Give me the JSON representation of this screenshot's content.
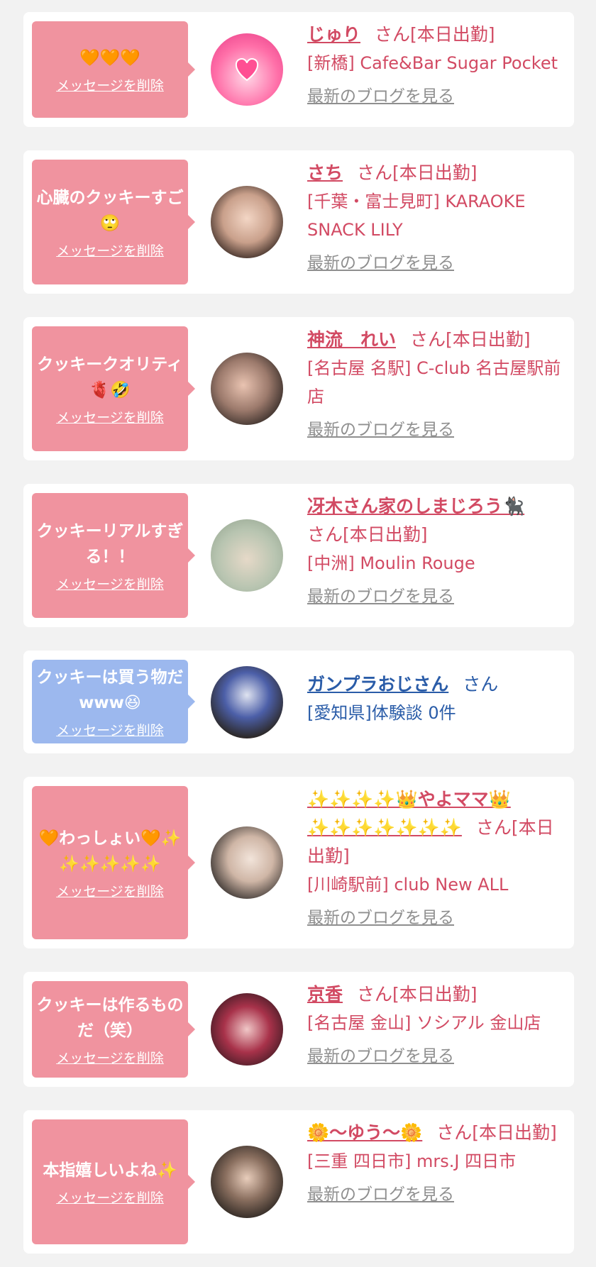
{
  "delete_label": "メッセージを削除",
  "blog_label": "最新のブログを見る",
  "cards": [
    {
      "message": "🧡🧡🧡",
      "name": "じゅり",
      "suffix": "さん[本日出勤]",
      "shop": "[新橋] Cafe&Bar Sugar Pocket"
    },
    {
      "message": "心臓のクッキーすご🙄",
      "name": "さち",
      "suffix": "さん[本日出勤]",
      "shop": "[千葉・富士見町] KARAOKE SNACK LILY"
    },
    {
      "message": "クッキークオリティ🫀🤣",
      "name": "神流　れい",
      "suffix": "さん[本日出勤]",
      "shop": "[名古屋 名駅] C-club 名古屋駅前店"
    },
    {
      "message": "クッキーリアルすぎる！！",
      "name": "冴木さん家のしまじろう🐈‍⬛",
      "suffix": "さん[本日出勤]",
      "shop": "[中洲] Moulin Rouge"
    },
    {
      "message": "クッキーは買う物だwww😆",
      "name": "ガンプラおじさん",
      "suffix": "さん",
      "shop": "[愛知県]体験談 0件"
    },
    {
      "message": "🧡わっしょい🧡✨✨✨✨✨✨",
      "name": "✨✨✨✨👑やよママ👑✨✨✨✨✨✨✨",
      "suffix": "さん[本日出勤]",
      "shop": "[川崎駅前] club New ALL"
    },
    {
      "message": "クッキーは作るものだ（笑）",
      "name": "京香",
      "suffix": "さん[本日出勤]",
      "shop": "[名古屋 金山] ソシアル 金山店"
    },
    {
      "message": "本指嬉しいよね✨",
      "name": "🌼〜ゆう〜🌼",
      "suffix": "さん[本日出勤]",
      "shop": "[三重 四日市] mrs.J 四日市"
    }
  ]
}
